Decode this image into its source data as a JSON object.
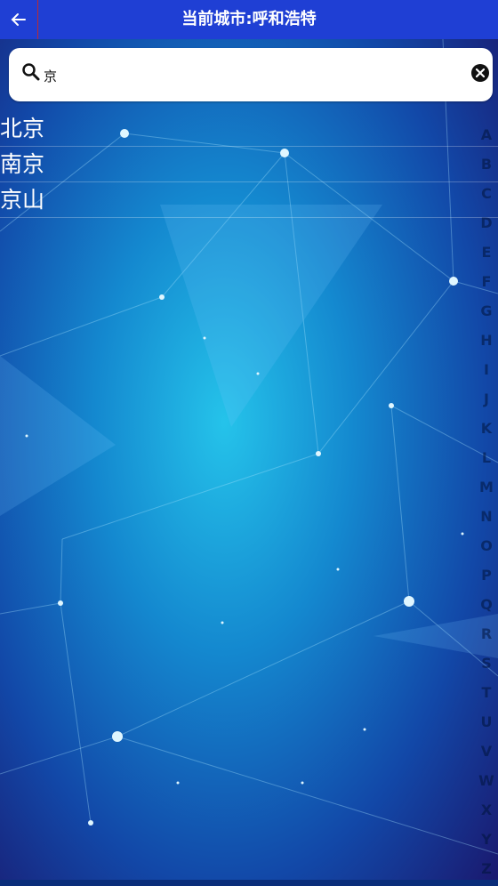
{
  "header": {
    "title": "当前城市:呼和浩特"
  },
  "search": {
    "value": "京",
    "placeholder": ""
  },
  "results": [
    "北京",
    "南京",
    "京山"
  ],
  "index_letters": [
    "A",
    "B",
    "C",
    "D",
    "E",
    "F",
    "G",
    "H",
    "I",
    "J",
    "K",
    "L",
    "M",
    "N",
    "O",
    "P",
    "Q",
    "R",
    "S",
    "T",
    "U",
    "V",
    "W",
    "X",
    "Y",
    "Z"
  ],
  "colors": {
    "header_bg": "#1f3fd4",
    "accent_border": "#b82c35",
    "index_text": "#1a2f5a"
  }
}
